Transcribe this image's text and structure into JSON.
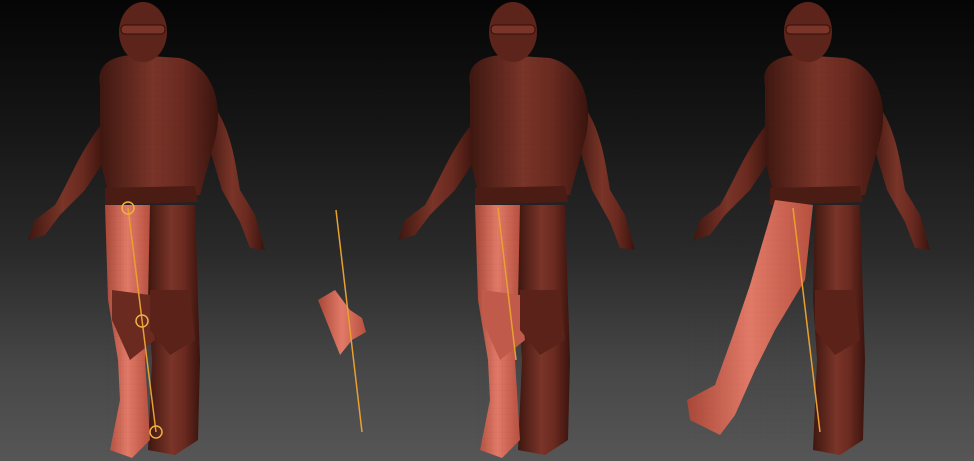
{
  "viewport": {
    "description_visible_text": "",
    "background": {
      "top": "#050505",
      "bottom": "#565656"
    }
  },
  "colors": {
    "clay_base": "#6e2e24",
    "clay_dark": "#3e1710",
    "clay_mid": "#8a3d30",
    "clay_highlight": "#a8584a",
    "masked_leg": "#c9604f",
    "masked_leg_light": "#e27a68",
    "transpose_line": "#e8a030",
    "transpose_handle": "#f0b040"
  },
  "panels": [
    {
      "name": "figure-1",
      "state": "transpose line placed on leg with three handles",
      "masked_leg": "right",
      "handles": 3
    },
    {
      "name": "detached-piece",
      "state": "isolated leg fragment with transpose line"
    },
    {
      "name": "figure-2",
      "state": "leg masked with transpose line",
      "masked_leg": "right",
      "handles": 0
    },
    {
      "name": "figure-3",
      "state": "leg rotated up with transpose",
      "masked_leg": "right-raised",
      "handles": 0
    }
  ]
}
